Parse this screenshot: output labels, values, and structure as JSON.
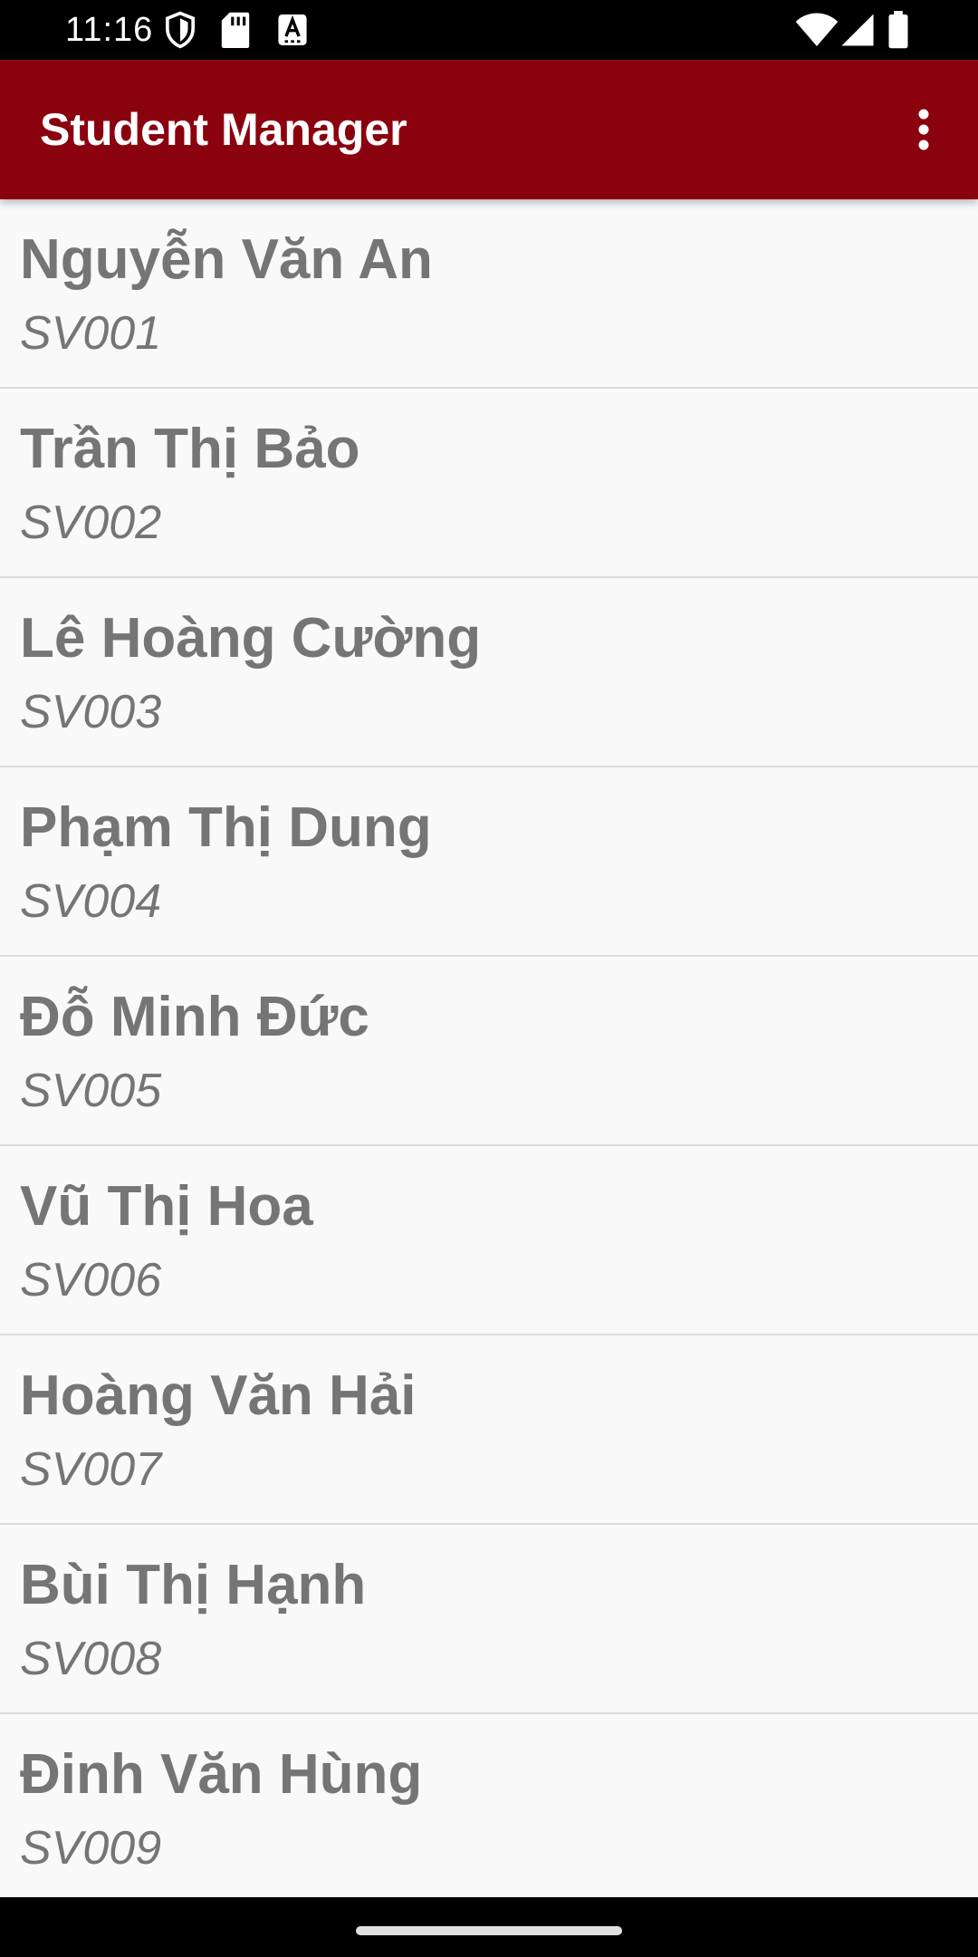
{
  "status_bar": {
    "time": "11:16",
    "icons_left": [
      "shield-icon",
      "sd-card-icon",
      "text-a-icon"
    ],
    "icons_right": [
      "wifi-icon",
      "cellular-signal-icon",
      "battery-icon"
    ]
  },
  "app_bar": {
    "title": "Student Manager",
    "menu_icon": "more-vert-icon",
    "background_color": "#8b020f"
  },
  "students": [
    {
      "name": "Nguyễn Văn An",
      "id": "SV001"
    },
    {
      "name": "Trần Thị Bảo",
      "id": "SV002"
    },
    {
      "name": "Lê Hoàng Cường",
      "id": "SV003"
    },
    {
      "name": "Phạm Thị Dung",
      "id": "SV004"
    },
    {
      "name": "Đỗ Minh Đức",
      "id": "SV005"
    },
    {
      "name": "Vũ Thị Hoa",
      "id": "SV006"
    },
    {
      "name": "Hoàng Văn Hải",
      "id": "SV007"
    },
    {
      "name": "Bùi Thị Hạnh",
      "id": "SV008"
    },
    {
      "name": "Đinh Văn Hùng",
      "id": "SV009"
    }
  ]
}
